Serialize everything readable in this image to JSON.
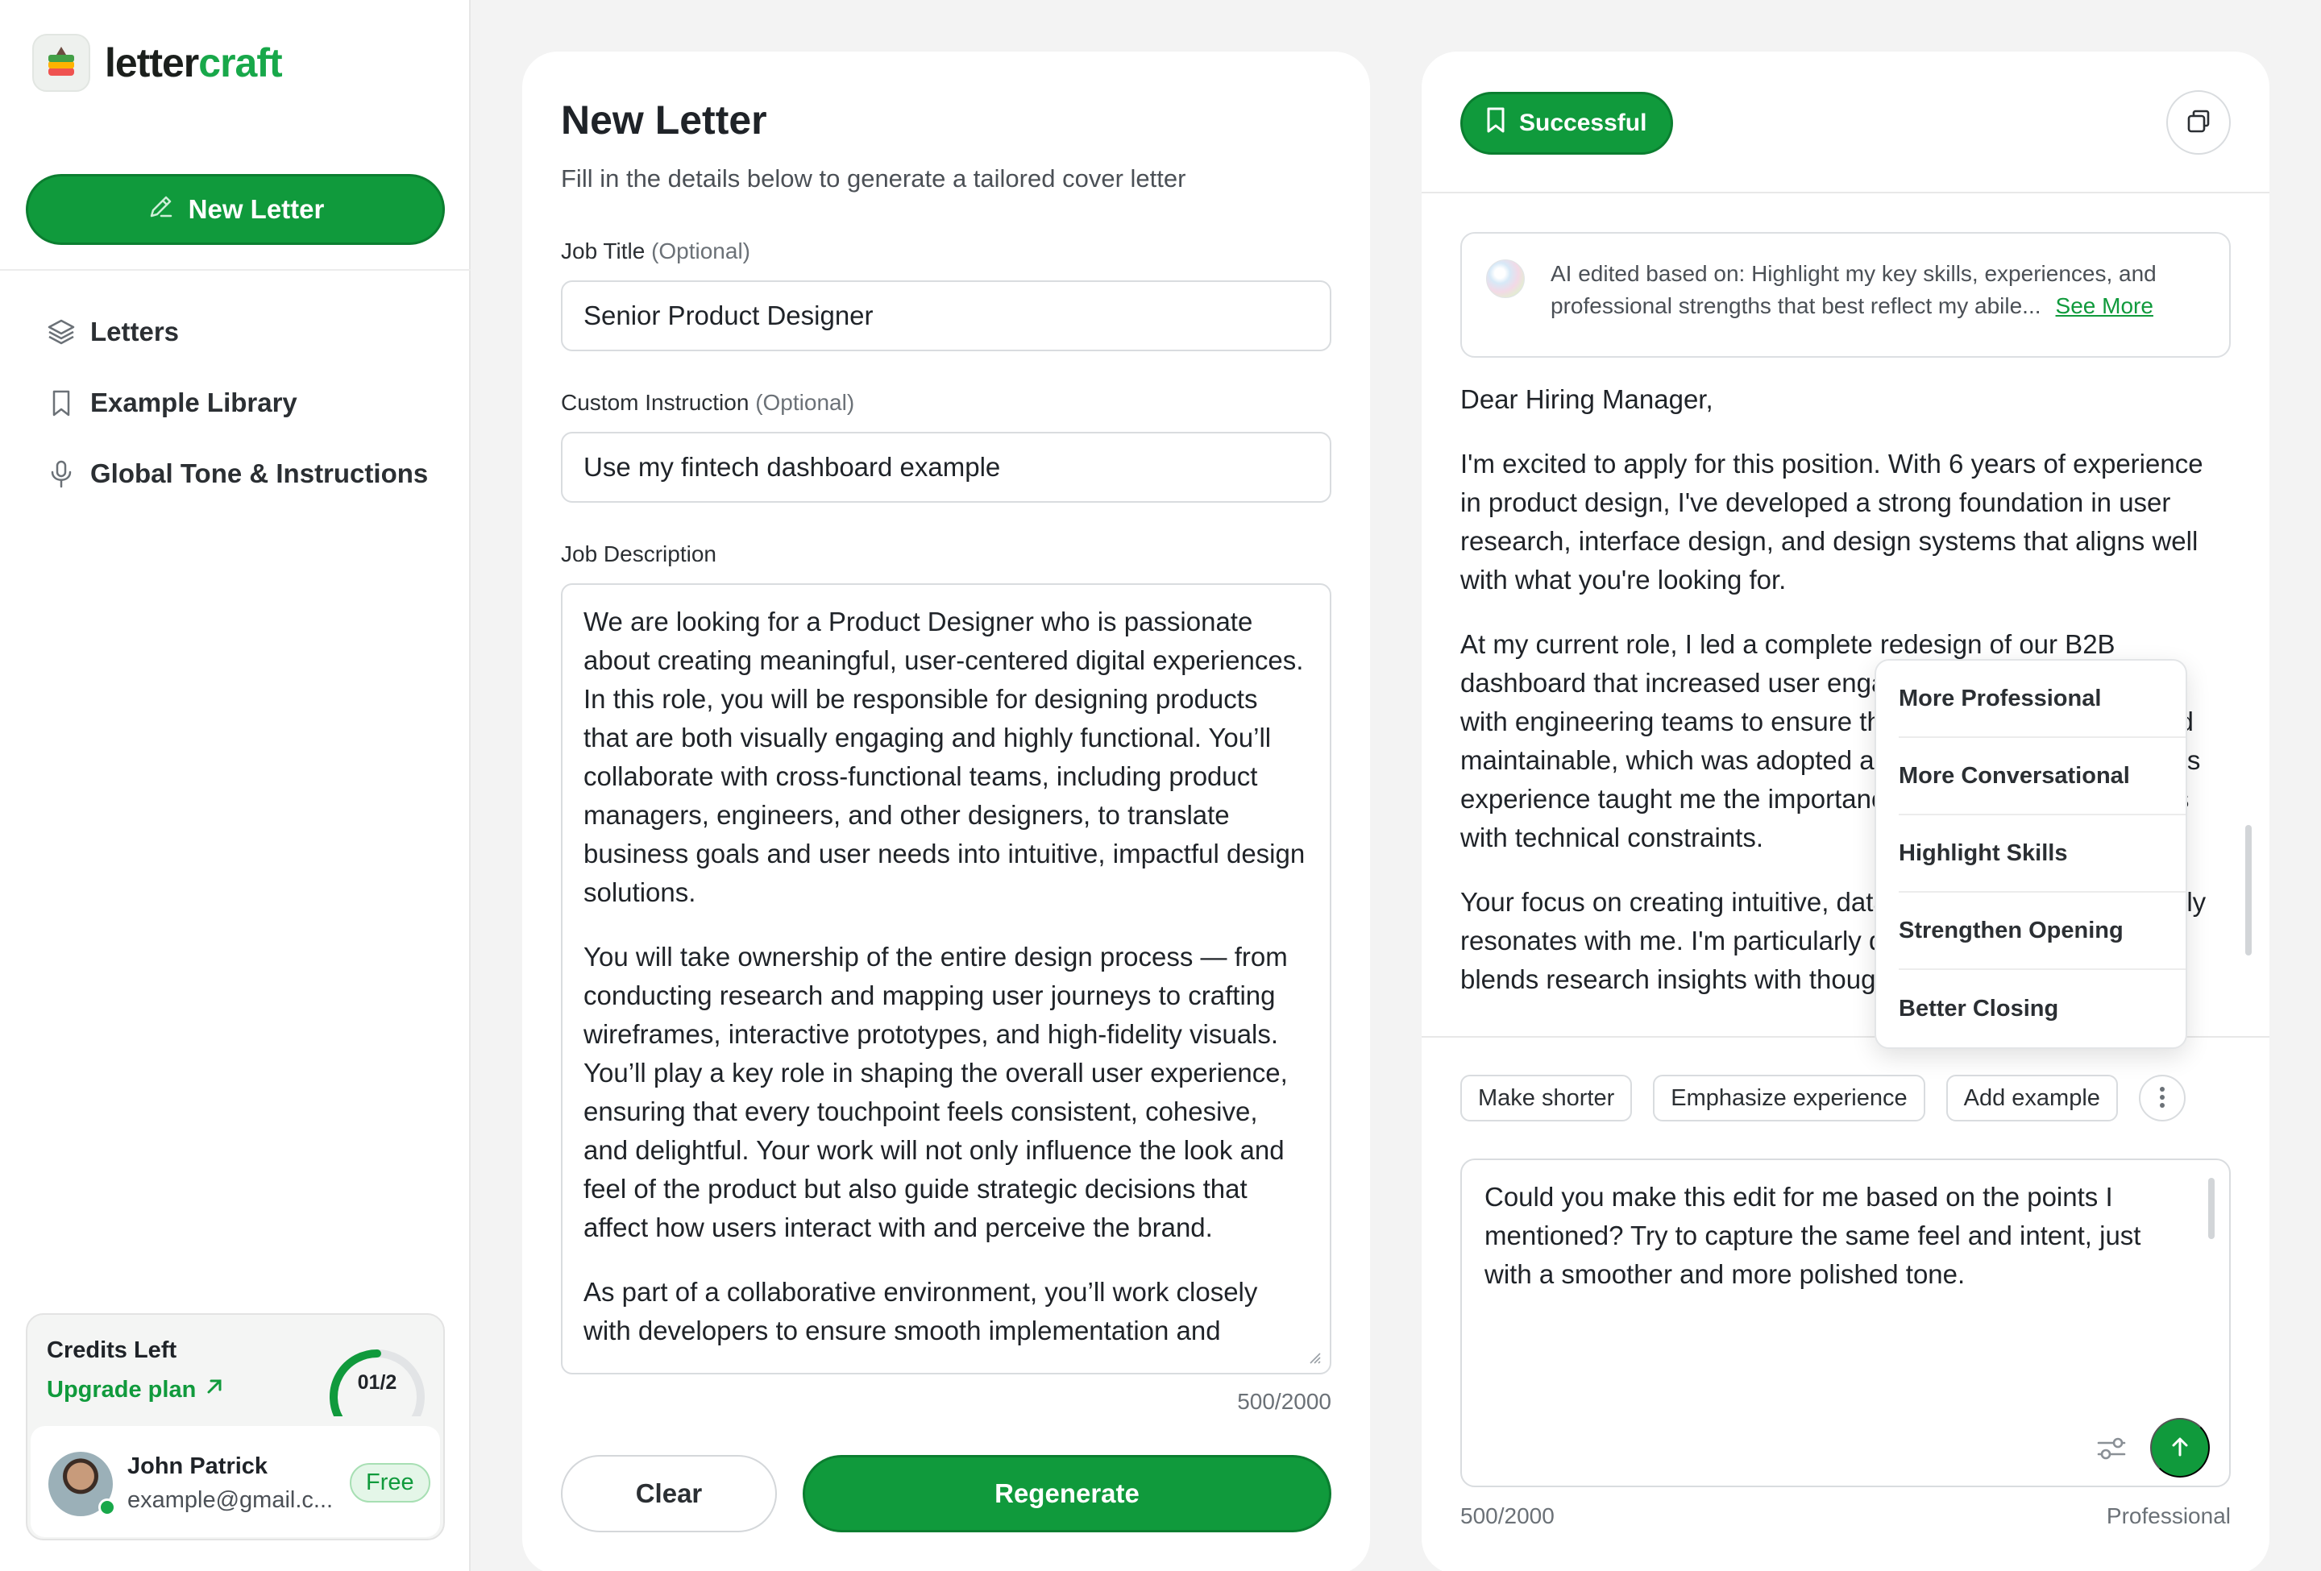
{
  "sidebar": {
    "logo": {
      "part1": "letter",
      "part2": "craft"
    },
    "new_letter_label": "New Letter",
    "nav": [
      {
        "label": "Letters",
        "icon": "layers-icon"
      },
      {
        "label": "Example Library",
        "icon": "bookmark-icon"
      },
      {
        "label": "Global Tone & Instructions",
        "icon": "microphone-icon"
      }
    ],
    "credits": {
      "title": "Credits Left",
      "upgrade_label": "Upgrade plan",
      "gauge_label": "01/2",
      "used_fraction": 0.5
    },
    "user": {
      "name": "John Patrick",
      "email": "example@gmail.c...",
      "plan_badge": "Free"
    }
  },
  "form": {
    "title": "New Letter",
    "subtitle": "Fill in the details below to generate a tailored cover letter",
    "job_title": {
      "label": "Job Title",
      "optional": "(Optional)",
      "value": "Senior Product Designer"
    },
    "custom_instruction": {
      "label": "Custom Instruction",
      "optional": "(Optional)",
      "value": "Use my fintech dashboard example"
    },
    "job_description": {
      "label": "Job Description",
      "paragraphs": [
        "We are looking for a Product Designer who is passionate about creating meaningful, user-centered digital experiences. In this role, you will be responsible for designing products that are both visually engaging and highly functional. You’ll collaborate with cross-functional teams, including product managers, engineers, and other designers, to translate business goals and user needs into intuitive, impactful design solutions.",
        "You will take ownership of the entire design process — from conducting research and mapping user journeys to crafting wireframes, interactive prototypes, and high-fidelity visuals. You’ll play a key role in shaping the overall user experience, ensuring that every touchpoint feels consistent, cohesive, and delightful. Your work will not only influence the look and feel of the product but also guide strategic decisions that affect how users interact with and perceive the brand.",
        "As part of a collaborative environment, you’ll work closely with developers to ensure smooth implementation and"
      ],
      "counter": "500/2000"
    },
    "clear_label": "Clear",
    "regenerate_label": "Regenerate"
  },
  "result": {
    "status_label": "Successful",
    "ai_note": {
      "text": "AI edited based on: Highlight my key skills, experiences, and professional strengths that best reflect my abile...",
      "see_more": "See More"
    },
    "letter_paragraphs": [
      "Dear Hiring Manager,",
      "I'm excited to apply for this position. With 6 years of experience in product design, I've developed a strong foundation in user research, interface design, and design systems that aligns well with what you're looking for.",
      "At my current role, I led a complete redesign of our B2B dashboard that increased user engagement. I worked closely with engineering teams to ensure the design was scalable and maintainable, which was adopted across 5 product teams. This experience taught me the importance of balancing user needs with technical constraints.",
      "Your focus on creating intuitive, data-driven experiences deeply resonates with me. I'm particularly drawn to how your team blends research insights with thoughtful design."
    ],
    "tone_menu": [
      "More Professional",
      "More Conversational",
      "Highlight Skills",
      "Strengthen Opening",
      "Better Closing"
    ],
    "chips": [
      "Make shorter",
      "Emphasize experience",
      "Add example"
    ],
    "prompt_text": "Could you make this edit for me based on the points I mentioned? Try to capture the same feel and intent, just with a smoother and more polished tone.",
    "counter": "500/2000",
    "tone": "Professional"
  },
  "colors": {
    "accent": "#109a3c",
    "accent_dark": "#0b7e30",
    "background": "#f3f3f3"
  }
}
